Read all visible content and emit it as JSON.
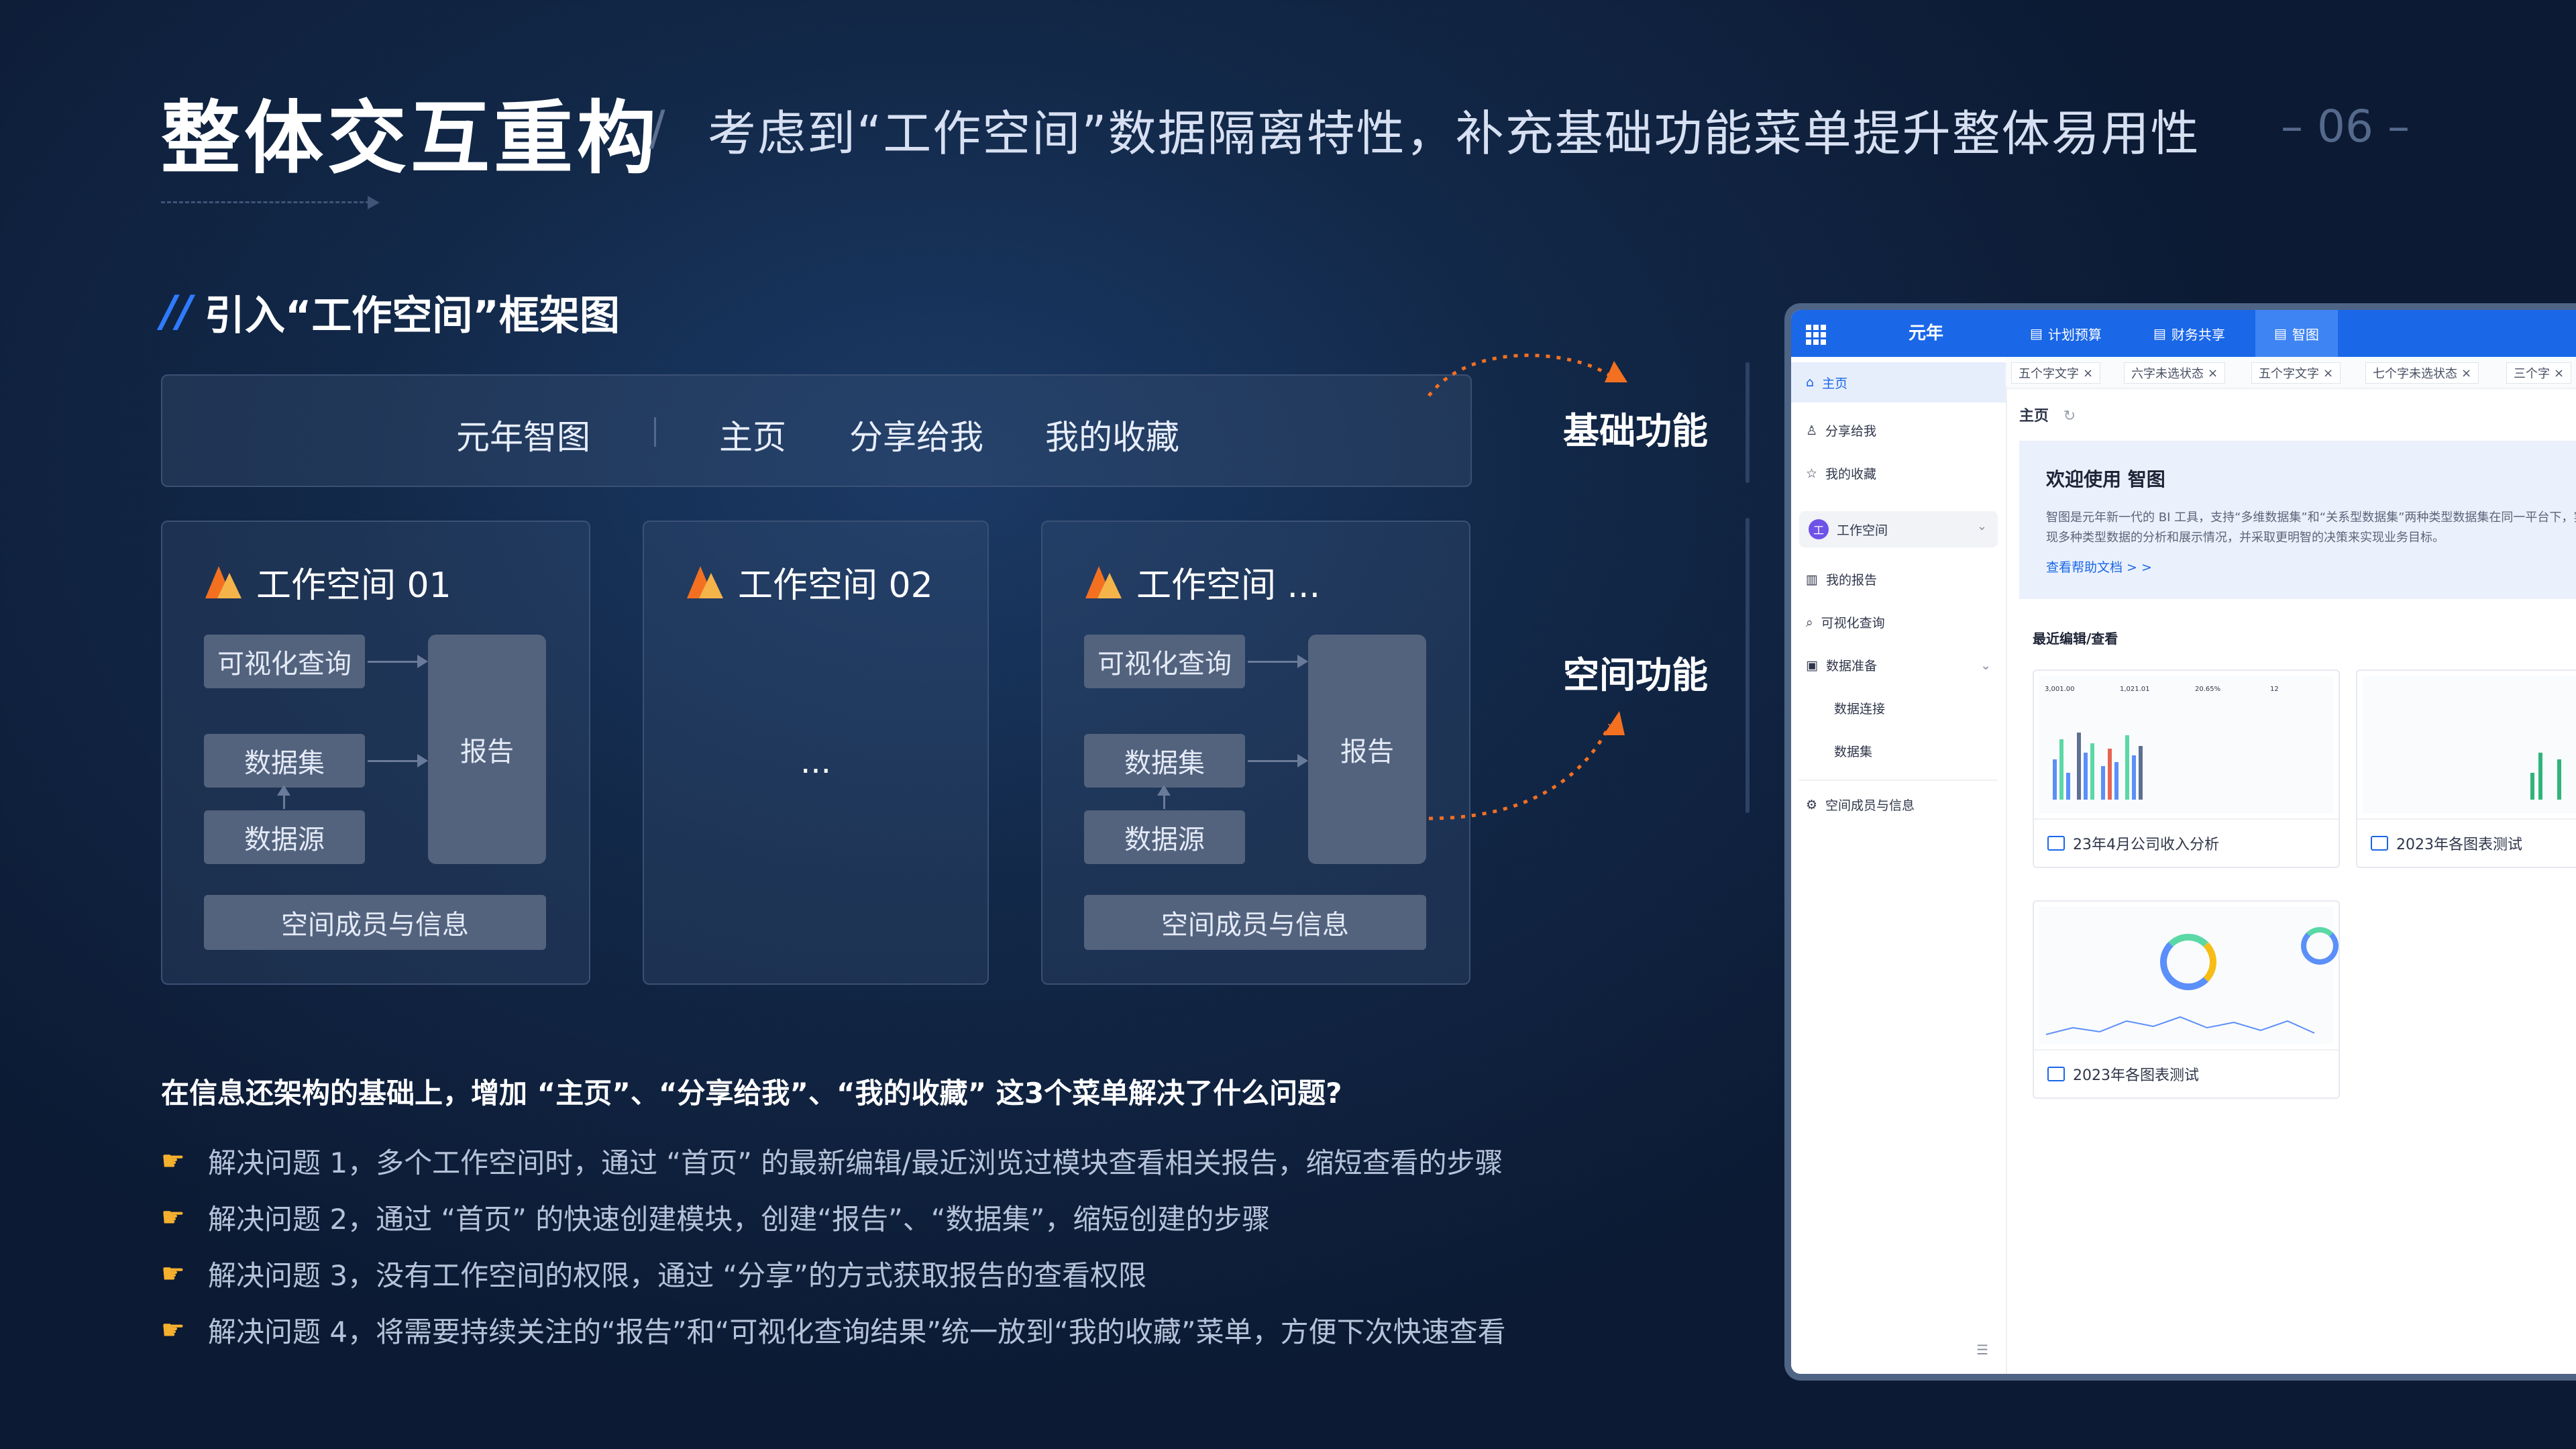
{
  "header": {
    "title": "整体交互重构",
    "slash": "/",
    "subtitle": "考虑到“工作空间”数据隔离特性，补充基础功能菜单提升整体易用性",
    "page_number": "– 06 –"
  },
  "section": {
    "marker": "//",
    "title": "引入“工作空间”框架图"
  },
  "diagram": {
    "nav": [
      "元年智图",
      "主页",
      "分享给我",
      "我的收藏"
    ],
    "workspaces": [
      {
        "title": "工作空间 01",
        "query": "可视化查询",
        "dataset": "数据集",
        "source": "数据源",
        "report": "报告",
        "members": "空间成员与信息"
      },
      {
        "title": "工作空间 02",
        "ellipsis": "..."
      },
      {
        "title": "工作空间 ...",
        "query": "可视化查询",
        "dataset": "数据集",
        "source": "数据源",
        "report": "报告",
        "members": "空间成员与信息"
      }
    ],
    "label_basic": "基础功能",
    "label_space": "空间功能"
  },
  "qa": {
    "question": "在信息还架构的基础上，增加 “主页”、“分享给我”、“我的收藏” 这3个菜单解决了什么问题?",
    "answers": [
      "解决问题 1，多个工作空间时，通过 “首页” 的最新编辑/最近浏览过模块查看相关报告，缩短查看的步骤",
      "解决问题 2，通过 “首页” 的快速创建模块，创建“报告”、“数据集”，缩短创建的步骤",
      "解决问题 3，没有工作空间的权限，通过 “分享”的方式获取报告的查看权限",
      "解决问题 4，将需要持续关注的“报告”和“可视化查询结果”统一放到“我的收藏”菜单，方便下次快速查看"
    ],
    "answer_icon": "pointing-hand-icon"
  },
  "app": {
    "logo": "元年",
    "topnav": [
      "计划预算",
      "财务共享",
      "智图"
    ],
    "active_topnav": "智图",
    "sidebar": {
      "home": "主页",
      "shared": "分享给我",
      "favorites": "我的收藏",
      "workspace": "工作空间",
      "workspace_badge": "工",
      "my_reports": "我的报告",
      "visual_query": "可视化查询",
      "data_prep": "数据准备",
      "data_connect": "数据连接",
      "dataset": "数据集",
      "members": "空间成员与信息"
    },
    "tabs": [
      "五个字文字",
      "六字未选状态",
      "五个字文字",
      "七个字未选状态",
      "三个字"
    ],
    "breadcrumb": "主页",
    "welcome": {
      "title": "欢迎使用 智图",
      "body": "智图是元年新一代的 BI 工具，支持“多维数据集”和“关系型数据集”两种类型数据集在同一平台下，实现多种类型数据的分析和展示情况，并采取更明智的决策来实现业务目标。",
      "help": "查看帮助文档 > >"
    },
    "recent_title": "最近编辑/查看",
    "cards": [
      "23年4月公司收入分析",
      "2023年各图表测试",
      "2023年各图表测试"
    ],
    "card_kpis": [
      "3,001.00",
      "1,021.01",
      "20.65%",
      "12"
    ]
  },
  "colors": {
    "accent": "#1a67e8",
    "orange": "#f37021",
    "background": "#122848"
  }
}
